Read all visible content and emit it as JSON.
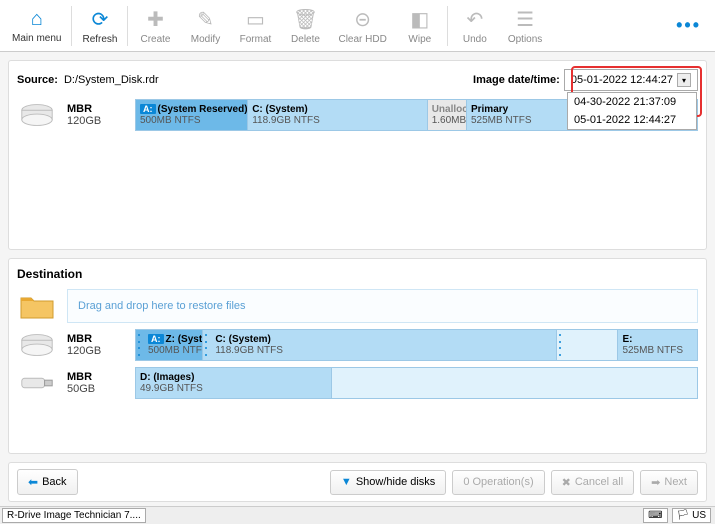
{
  "toolbar": {
    "main_menu": "Main menu",
    "refresh": "Refresh",
    "create": "Create",
    "modify": "Modify",
    "format": "Format",
    "delete": "Delete",
    "clear_hdd": "Clear HDD",
    "wipe": "Wipe",
    "undo": "Undo",
    "options": "Options"
  },
  "source": {
    "label": "Source:",
    "path": "D:/System_Disk.rdr",
    "dt_label": "Image date/time:",
    "dt_value": "05-01-2022 12:44:27",
    "dt_options": [
      "04-30-2022 21:37:09",
      "05-01-2022 12:44:27"
    ],
    "disk": {
      "type": "MBR",
      "size": "120GB"
    },
    "partitions": {
      "res_name": "(System Reserved)",
      "res_sub": "500MB NTFS",
      "sys_name": "C: (System)",
      "sys_sub": "118.9GB NTFS",
      "un_name": "Unallocat",
      "un_sub": "1.60MB",
      "pri_name": "Primary",
      "pri_sub": "525MB NTFS"
    }
  },
  "dest": {
    "title": "Destination",
    "drop_hint": "Drag and drop here to restore files",
    "disk1": {
      "type": "MBR",
      "size": "120GB"
    },
    "disk1_parts": {
      "z_name": "Z: (System Re",
      "z_sub": "500MB NTFS",
      "c_name": "C: (System)",
      "c_sub": "118.9GB NTFS",
      "e_name": "E:",
      "e_sub": "525MB NTFS"
    },
    "disk2": {
      "type": "MBR",
      "size": "50GB"
    },
    "disk2_parts": {
      "d_name": "D: (Images)",
      "d_sub": "49.9GB NTFS"
    }
  },
  "footer": {
    "back": "Back",
    "show_hide": "Show/hide disks",
    "ops": "0 Operation(s)",
    "cancel": "Cancel all",
    "next": "Next"
  },
  "status": {
    "app": "R-Drive Image Technician 7....",
    "kb": "⌨",
    "lang": "US"
  }
}
